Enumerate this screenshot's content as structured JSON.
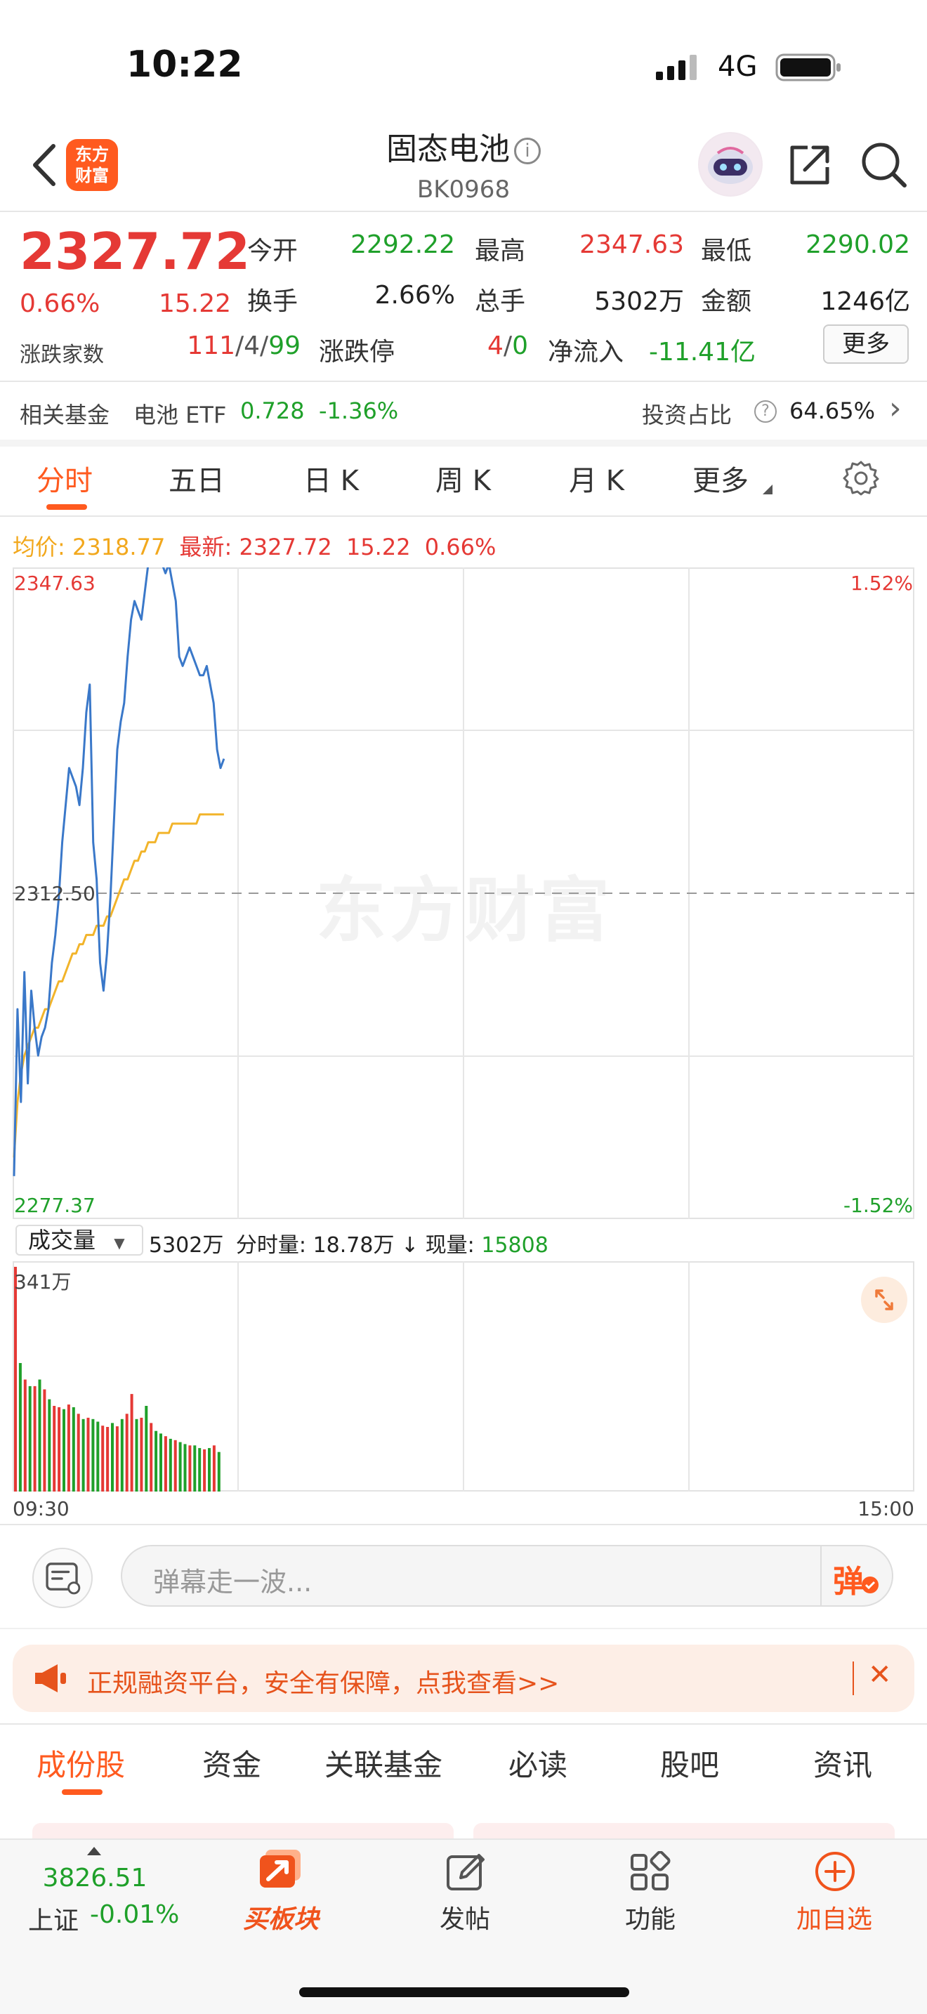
{
  "status_bar": {
    "time": "10:22",
    "network": "4G"
  },
  "header": {
    "logo_line1": "东方",
    "logo_line2": "财富",
    "title": "固态电池",
    "info_glyph": "i",
    "code": "BK0968"
  },
  "quote": {
    "price": "2327.72",
    "change_pct": "0.66%",
    "change": "15.22",
    "open_label": "今开",
    "open": "2292.22",
    "high_label": "最高",
    "high": "2347.63",
    "low_label": "最低",
    "low": "2290.02",
    "turnover_label": "换手",
    "turnover": "2.66%",
    "volume_label": "总手",
    "volume": "5302万",
    "amount_label": "金额",
    "amount": "1246亿",
    "breadth_label": "涨跌家数",
    "breadth_up": "111",
    "breadth_sep1": "/",
    "breadth_flat": "4",
    "breadth_sep2": "/",
    "breadth_down": "99",
    "limit_label": "涨跌停",
    "limit_up": "4",
    "limit_sep": "/",
    "limit_down": "0",
    "netflow_label": "净流入",
    "netflow": "-11.41亿",
    "more_label": "更多"
  },
  "fund_row": {
    "label": "相关基金",
    "fund_name": "电池 ETF",
    "fund_price": "0.728",
    "fund_pct": "-1.36%",
    "ratio_label": "投资占比",
    "help_glyph": "?",
    "ratio": "64.65%",
    "arrow": "›"
  },
  "chart_tabs": [
    {
      "label": "分时",
      "active": true
    },
    {
      "label": "五日"
    },
    {
      "label": "日 K"
    },
    {
      "label": "周 K"
    },
    {
      "label": "月 K"
    },
    {
      "label": "更多"
    }
  ],
  "chart_info": {
    "avg_label": "均价:",
    "avg_value": "2318.77",
    "last_label": "最新:",
    "last_value": "2327.72",
    "last_change": "15.22",
    "last_pct": "0.66%"
  },
  "chart_axis": {
    "top_price": "2347.63",
    "mid_price": "2312.50",
    "bottom_price": "2277.37",
    "top_pct": "1.52%",
    "bottom_pct": "-1.52%",
    "vol_max": "341万",
    "time_start": "09:30",
    "time_end": "15:00"
  },
  "watermark": "东方财富",
  "volume_bar": {
    "select_label": "成交量",
    "select_arrow": "▼",
    "total": "5302万",
    "tick_label": "分时量:",
    "tick_value": "18.78万",
    "tick_arrow": "↓",
    "now_label": "现量:",
    "now_value": "15808"
  },
  "chart_data": [
    {
      "type": "line",
      "title": "",
      "x_range": [
        "09:30",
        "15:00"
      ],
      "ylim": [
        2277.37,
        2347.63
      ],
      "reference": 2312.5,
      "series": [
        {
          "name": "最新",
          "color": "#3a78c9",
          "values": [
            2282,
            2300,
            2290,
            2304,
            2292,
            2302,
            2298,
            2295,
            2297,
            2298,
            2300,
            2305,
            2308,
            2312,
            2318,
            2322,
            2326,
            2325,
            2324,
            2322,
            2326,
            2332,
            2335,
            2318,
            2314,
            2305,
            2302,
            2306,
            2312,
            2320,
            2328,
            2331,
            2333,
            2338,
            2342,
            2344,
            2343,
            2342,
            2345,
            2348,
            2349,
            2350,
            2349,
            2348,
            2347,
            2348,
            2346,
            2344,
            2338,
            2337,
            2338,
            2339,
            2338,
            2337,
            2336,
            2336,
            2337,
            2335,
            2333,
            2328,
            2326,
            2327
          ]
        },
        {
          "name": "均价",
          "color": "#f2b42a",
          "values": [
            2284,
            2290,
            2293,
            2295,
            2296,
            2297,
            2298,
            2298,
            2299,
            2300,
            2300,
            2301,
            2302,
            2303,
            2303,
            2304,
            2305,
            2306,
            2306,
            2307,
            2307,
            2308,
            2308,
            2308,
            2309,
            2309,
            2309,
            2310,
            2310,
            2311,
            2312,
            2313,
            2314,
            2314,
            2315,
            2316,
            2316,
            2317,
            2317,
            2318,
            2318,
            2318,
            2319,
            2319,
            2319,
            2319,
            2320,
            2320,
            2320,
            2320,
            2320,
            2320,
            2320,
            2320,
            2321,
            2321,
            2321,
            2321,
            2321,
            2321,
            2321,
            2321
          ]
        }
      ]
    },
    {
      "type": "bar",
      "title": "",
      "ylim": [
        0,
        341
      ],
      "unit": "万",
      "values": [
        341,
        195,
        170,
        160,
        160,
        170,
        155,
        140,
        130,
        128,
        125,
        132,
        128,
        118,
        110,
        112,
        110,
        106,
        100,
        98,
        104,
        99,
        110,
        118,
        148,
        110,
        112,
        130,
        104,
        92,
        88,
        84,
        80,
        78,
        75,
        72,
        70,
        70,
        66,
        64,
        66,
        70,
        60
      ],
      "up": [
        true,
        false,
        true,
        false,
        true,
        false,
        true,
        false,
        true,
        true,
        false,
        true,
        false,
        true,
        false,
        true,
        false,
        false,
        true,
        true,
        false,
        true,
        false,
        true,
        true,
        false,
        true,
        false,
        true,
        false,
        false,
        true,
        false,
        true,
        false,
        false,
        true,
        false,
        false,
        true,
        false,
        true,
        false
      ]
    }
  ],
  "danmaku": {
    "placeholder": "弹幕走一波...",
    "button": "弹"
  },
  "banner": {
    "text": "正规融资平台，安全有保障，点我查看>>",
    "close": "✕"
  },
  "bottom_tabs": [
    {
      "label": "成份股",
      "active": true
    },
    {
      "label": "资金"
    },
    {
      "label": "关联基金"
    },
    {
      "label": "必读"
    },
    {
      "label": "股吧"
    },
    {
      "label": "资讯"
    }
  ],
  "bottom_nav": {
    "index_value": "3826.51",
    "index_name": "上证",
    "index_pct": "-0.01%",
    "buy_label": "买板块",
    "post_label": "发帖",
    "func_label": "功能",
    "watch_label": "加自选"
  },
  "colors": {
    "up": "#e53935",
    "down": "#1fa02a",
    "accent": "#ff5a1f",
    "price_line": "#3a78c9",
    "avg_line": "#f2b42a"
  }
}
